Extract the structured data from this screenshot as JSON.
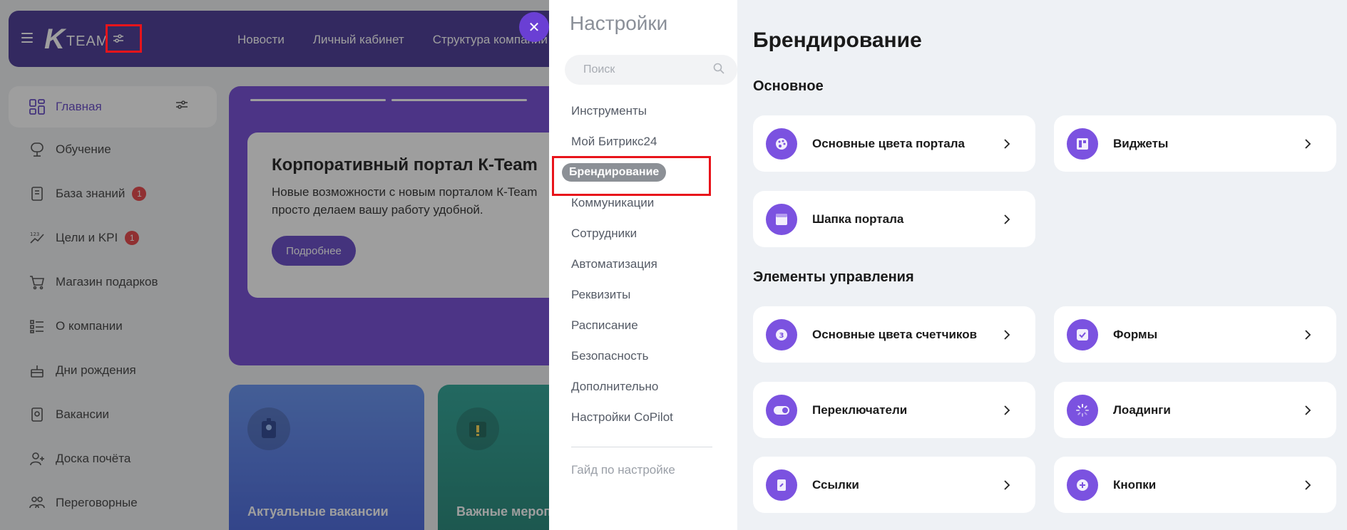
{
  "portal": {
    "logo_k": "K",
    "logo_team": "TEAM",
    "nav": [
      "Новости",
      "Личный кабинет",
      "Структура компании"
    ],
    "sidebar": [
      {
        "label": "Главная",
        "icon": "dashboard-icon",
        "active": true
      },
      {
        "label": "Обучение",
        "icon": "learning-icon"
      },
      {
        "label": "База знаний",
        "icon": "book-icon",
        "badge": "1"
      },
      {
        "label": "Цели и KPI",
        "icon": "kpi-icon",
        "badge": "1"
      },
      {
        "label": "Магазин подарков",
        "icon": "cart-icon"
      },
      {
        "label": "О компании",
        "icon": "list-icon"
      },
      {
        "label": "Дни рождения",
        "icon": "cake-icon"
      },
      {
        "label": "Вакансии",
        "icon": "vacancy-icon"
      },
      {
        "label": "Доска почёта",
        "icon": "honor-icon"
      },
      {
        "label": "Переговорные",
        "icon": "meeting-icon"
      }
    ],
    "hero": {
      "title": "Корпоративный портал К-Team",
      "text_line1": "Новые возможности с новым порталом К-Team",
      "text_line2": "просто делаем вашу работу удобной.",
      "button": "Подробнее"
    },
    "tiles": [
      "Актуальные вакансии",
      "Важные мероприятия"
    ]
  },
  "settings": {
    "title": "Настройки",
    "search_placeholder": "Поиск",
    "menu": [
      "Инструменты",
      "Мой Битрикс24",
      "Брендирование",
      "Коммуникации",
      "Сотрудники",
      "Автоматизация",
      "Реквизиты",
      "Расписание",
      "Безопасность",
      "Дополнительно",
      "Настройки CoPilot"
    ],
    "active_index": 2,
    "guide": "Гайд по настройке"
  },
  "branding": {
    "title": "Брендирование",
    "section_main": "Основное",
    "section_controls": "Элементы управления",
    "main_cards": [
      {
        "label": "Основные цвета портала",
        "icon": "palette-icon"
      },
      {
        "label": "Виджеты",
        "icon": "widget-icon"
      },
      {
        "label": "Шапка портала",
        "icon": "header-icon"
      }
    ],
    "control_cards": [
      {
        "label": "Основные цвета счетчиков",
        "icon": "counter-icon"
      },
      {
        "label": "Формы",
        "icon": "form-icon"
      },
      {
        "label": "Переключатели",
        "icon": "toggle-icon"
      },
      {
        "label": "Лоадинги",
        "icon": "loader-icon"
      },
      {
        "label": "Ссылки",
        "icon": "link-icon"
      },
      {
        "label": "Кнопки",
        "icon": "plus-circle-icon"
      }
    ]
  },
  "colors": {
    "accent": "#6a3fd4",
    "topbar": "#3d2a8f",
    "highlight": "#e8141b",
    "active_pill": "#8c9096"
  }
}
